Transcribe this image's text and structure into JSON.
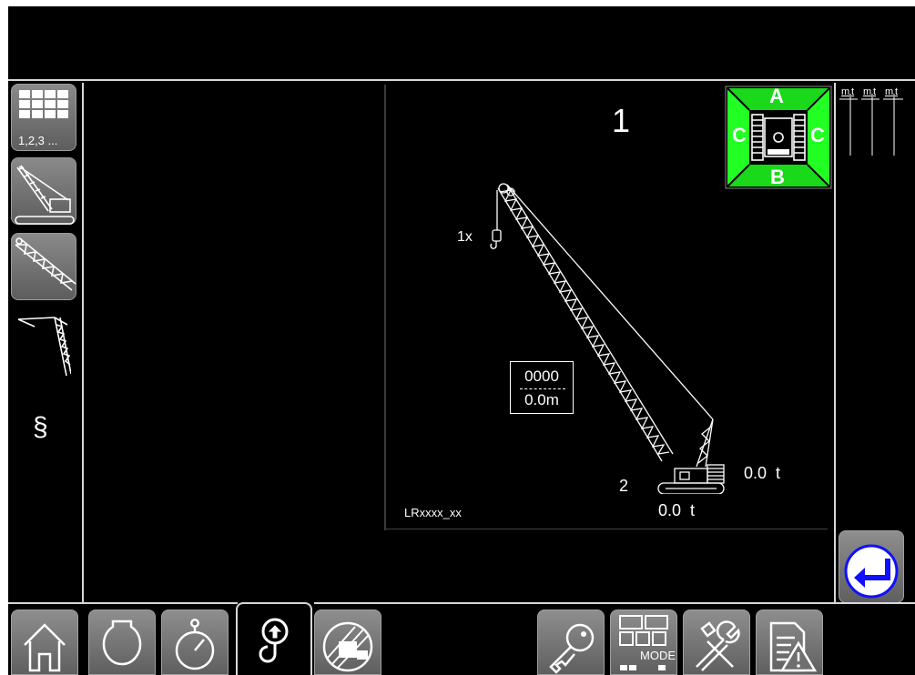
{
  "sidebar": {
    "configs_label": "1,2,3 ...",
    "paragraph_symbol": "§"
  },
  "main": {
    "hook_number": "1",
    "hook_count": "1x",
    "radius_top": "0000",
    "radius_bottom": "0.0m",
    "load_right": "0.0  t",
    "load_bottom": "0.0  t",
    "crane_number": "2",
    "model": "LRxxxx_xx"
  },
  "compass": {
    "top": "A",
    "left": "C",
    "right": "C",
    "bottom": "B",
    "color": "#22ff22"
  },
  "right_panel": {
    "labels": [
      "m",
      "t",
      "m",
      "t",
      "m",
      "t"
    ]
  },
  "bottom_bar": {
    "mode_label": "MODE"
  },
  "colors": {
    "accent_blue": "#1010ff",
    "background": "#000000",
    "button_gray": "#7a7a7a"
  }
}
